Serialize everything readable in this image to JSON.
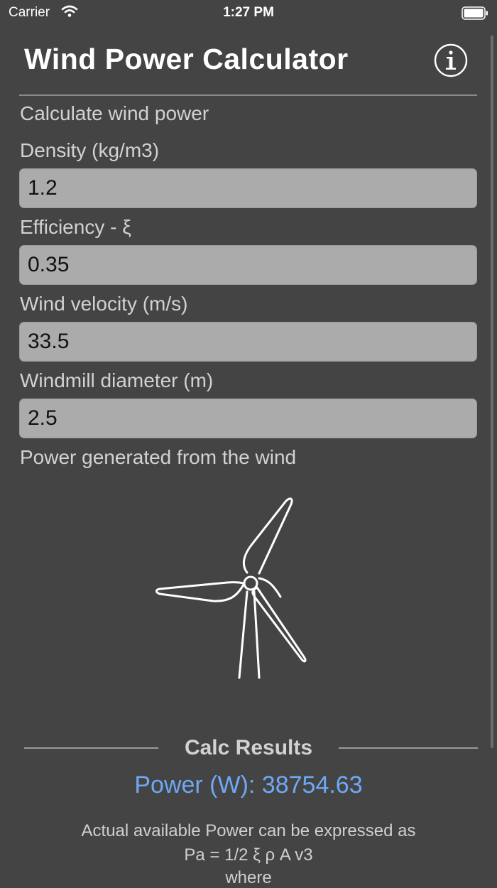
{
  "status": {
    "carrier": "Carrier",
    "time": "1:27 PM"
  },
  "header": {
    "title": "Wind Power Calculator",
    "info_icon": "info-circle-icon"
  },
  "form": {
    "intro": "Calculate wind power",
    "density_label": "Density (kg/m3)",
    "density_value": "1.2",
    "efficiency_label": "Efficiency - ξ",
    "efficiency_value": "0.35",
    "velocity_label": "Wind velocity (m/s)",
    "velocity_value": "33.5",
    "diameter_label": "Windmill diameter (m)",
    "diameter_value": "2.5",
    "power_label": "Power generated from the wind"
  },
  "illustration": {
    "icon": "wind-turbine-icon"
  },
  "results": {
    "title": "Calc Results",
    "power": "Power (W): 38754.63",
    "note_line1": "Actual available Power can be expressed as",
    "note_line2": "Pa = 1/2 ξ ρ A v3",
    "note_line3": "where"
  },
  "colors": {
    "background": "#444444",
    "field": "#ababab",
    "accent": "#6fa8f5"
  }
}
